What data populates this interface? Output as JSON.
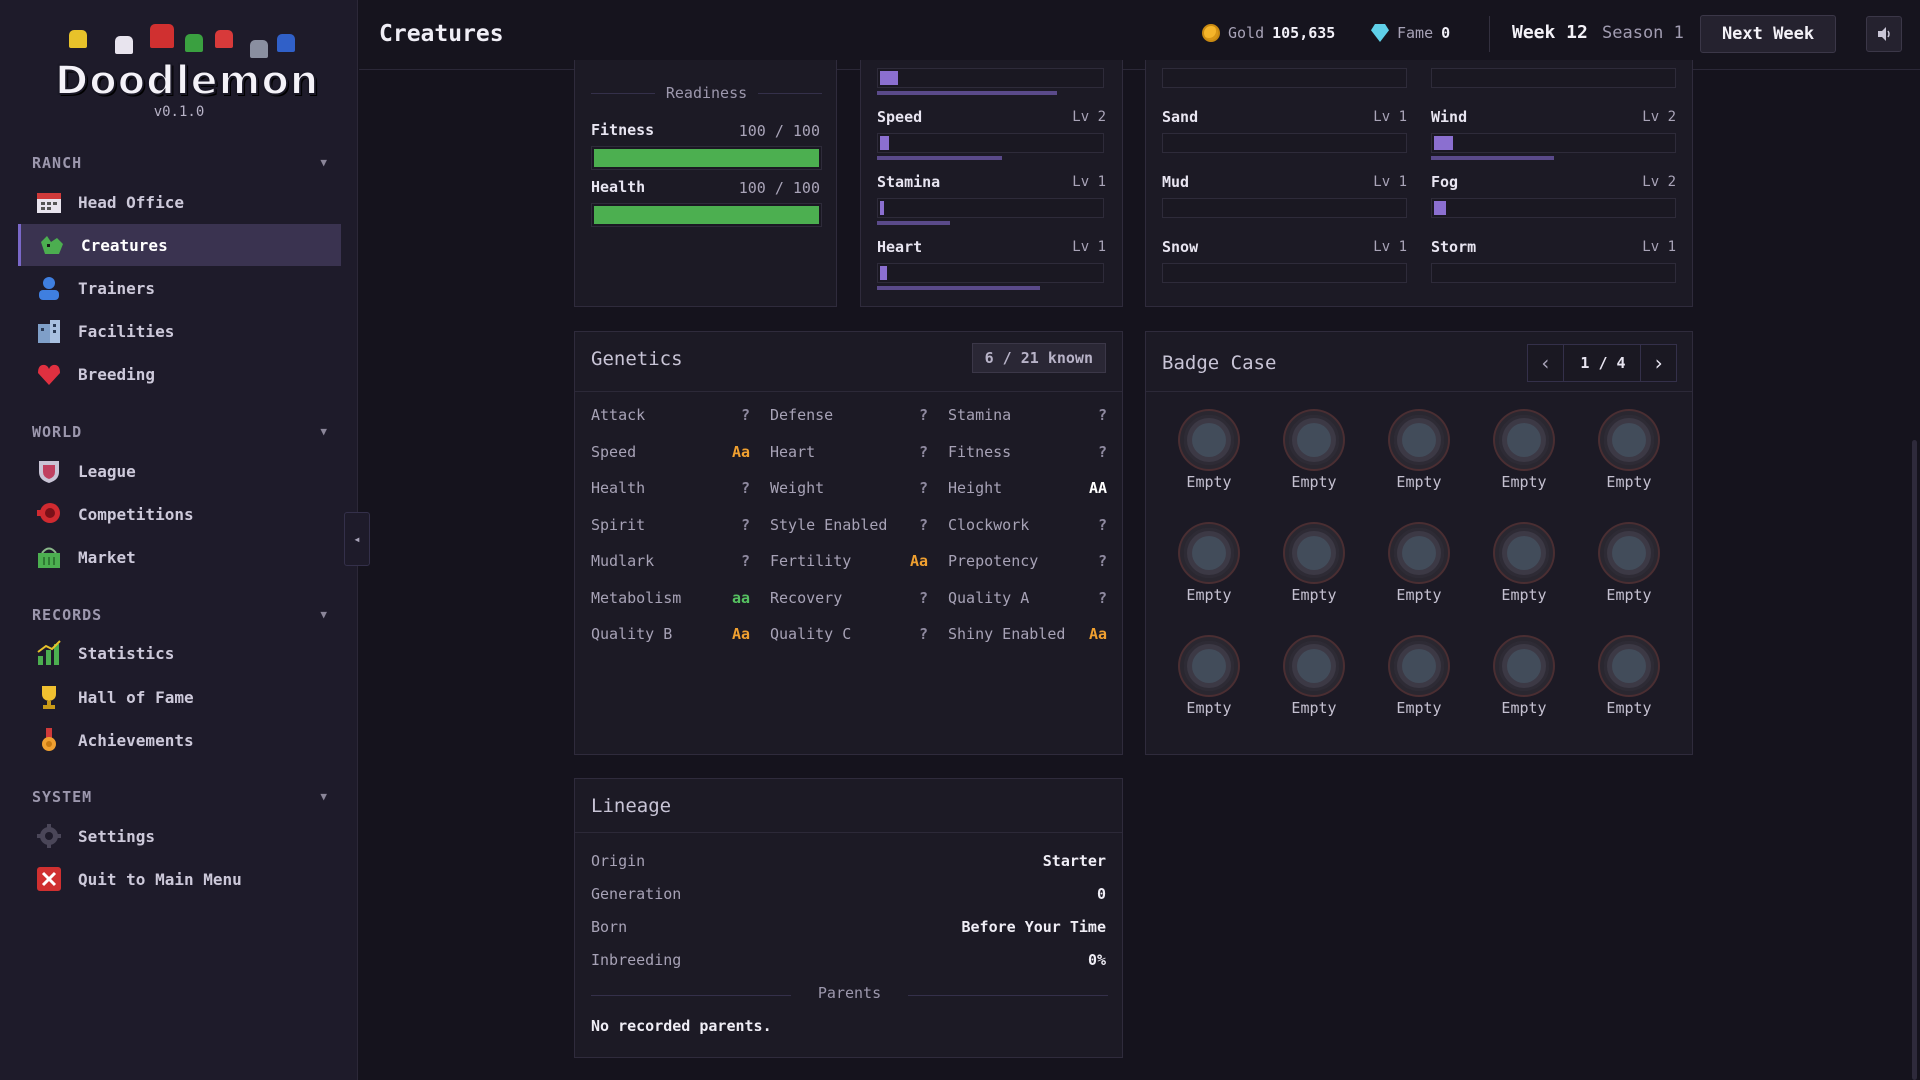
{
  "app": {
    "logo": "Doodlemon",
    "version": "v0.1.0"
  },
  "sidebar": {
    "sections": [
      {
        "title": "RANCH",
        "items": [
          "Head Office",
          "Creatures",
          "Trainers",
          "Facilities",
          "Breeding"
        ]
      },
      {
        "title": "WORLD",
        "items": [
          "League",
          "Competitions",
          "Market"
        ]
      },
      {
        "title": "RECORDS",
        "items": [
          "Statistics",
          "Hall of Fame",
          "Achievements"
        ]
      },
      {
        "title": "SYSTEM",
        "items": [
          "Settings",
          "Quit to Main Menu"
        ]
      }
    ],
    "active": "Creatures",
    "collapse_glyph": "◂"
  },
  "header": {
    "title": "Creatures",
    "gold_label": "Gold",
    "gold_value": "105,635",
    "fame_label": "Fame",
    "fame_value": "0",
    "week": "Week 12",
    "season": "Season 1",
    "next_week": "Next Week"
  },
  "readiness": {
    "heading": "Readiness",
    "fitness": {
      "label": "Fitness",
      "value": "100 / 100",
      "fraction": 1.0
    },
    "health": {
      "label": "Health",
      "value": "100 / 100",
      "fraction": 1.0
    }
  },
  "stats": [
    {
      "name": "Speed",
      "level": "Lv 2",
      "fill": 0.04,
      "under": 0.55
    },
    {
      "name": "Stamina",
      "level": "Lv 1",
      "fill": 0.01,
      "under": 0.32
    },
    {
      "name": "Heart",
      "level": "Lv 1",
      "fill": 0.03,
      "under": 0.72
    }
  ],
  "terrain": {
    "left": [
      {
        "name": "Sand",
        "level": "Lv 1",
        "fill": 0
      },
      {
        "name": "Mud",
        "level": "Lv 1",
        "fill": 0
      },
      {
        "name": "Snow",
        "level": "Lv 1",
        "fill": 0
      }
    ],
    "right": [
      {
        "name": "Wind",
        "level": "Lv 2",
        "fill": 0.08,
        "under": 0.5
      },
      {
        "name": "Fog",
        "level": "Lv 2",
        "fill": 0.05
      },
      {
        "name": "Storm",
        "level": "Lv 1",
        "fill": 0
      }
    ]
  },
  "genetics": {
    "title": "Genetics",
    "known": "6 / 21 known",
    "colors": {
      "dominant": "#f0a030",
      "recessive": "#55c060",
      "unknown": "#8f8aa0",
      "known_rec": "#ffffff"
    },
    "rows": [
      [
        {
          "label": "Attack",
          "value": "?",
          "kind": "unknown"
        },
        {
          "label": "Defense",
          "value": "?",
          "kind": "unknown"
        },
        {
          "label": "Stamina",
          "value": "?",
          "kind": "unknown"
        }
      ],
      [
        {
          "label": "Speed",
          "value": "Aa",
          "kind": "dominant"
        },
        {
          "label": "Heart",
          "value": "?",
          "kind": "unknown"
        },
        {
          "label": "Fitness",
          "value": "?",
          "kind": "unknown"
        }
      ],
      [
        {
          "label": "Health",
          "value": "?",
          "kind": "unknown"
        },
        {
          "label": "Weight",
          "value": "?",
          "kind": "unknown"
        },
        {
          "label": "Height",
          "value": "AA",
          "kind": "known_rec"
        }
      ],
      [
        {
          "label": "Spirit",
          "value": "?",
          "kind": "unknown"
        },
        {
          "label": "Style Enabled",
          "value": "?",
          "kind": "unknown"
        },
        {
          "label": "Clockwork",
          "value": "?",
          "kind": "unknown"
        }
      ],
      [
        {
          "label": "Mudlark",
          "value": "?",
          "kind": "unknown"
        },
        {
          "label": "Fertility",
          "value": "Aa",
          "kind": "dominant"
        },
        {
          "label": "Prepotency",
          "value": "?",
          "kind": "unknown"
        }
      ],
      [
        {
          "label": "Metabolism",
          "value": "aa",
          "kind": "recessive"
        },
        {
          "label": "Recovery",
          "value": "?",
          "kind": "unknown"
        },
        {
          "label": "Quality A",
          "value": "?",
          "kind": "unknown"
        }
      ],
      [
        {
          "label": "Quality B",
          "value": "Aa",
          "kind": "dominant"
        },
        {
          "label": "Quality C",
          "value": "?",
          "kind": "unknown"
        },
        {
          "label": "Shiny Enabled",
          "value": "Aa",
          "kind": "dominant"
        }
      ]
    ]
  },
  "badges": {
    "title": "Badge Case",
    "page": "1 / 4",
    "prev": "‹",
    "next": "›",
    "slots": [
      "Empty",
      "Empty",
      "Empty",
      "Empty",
      "Empty",
      "Empty",
      "Empty",
      "Empty",
      "Empty",
      "Empty",
      "Empty",
      "Empty",
      "Empty",
      "Empty",
      "Empty"
    ]
  },
  "lineage": {
    "title": "Lineage",
    "rows": [
      {
        "label": "Origin",
        "value": "Starter"
      },
      {
        "label": "Generation",
        "value": "0"
      },
      {
        "label": "Born",
        "value": "Before Your Time"
      },
      {
        "label": "Inbreeding",
        "value": "0%"
      }
    ],
    "parents_heading": "Parents",
    "parents_text": "No recorded parents."
  }
}
